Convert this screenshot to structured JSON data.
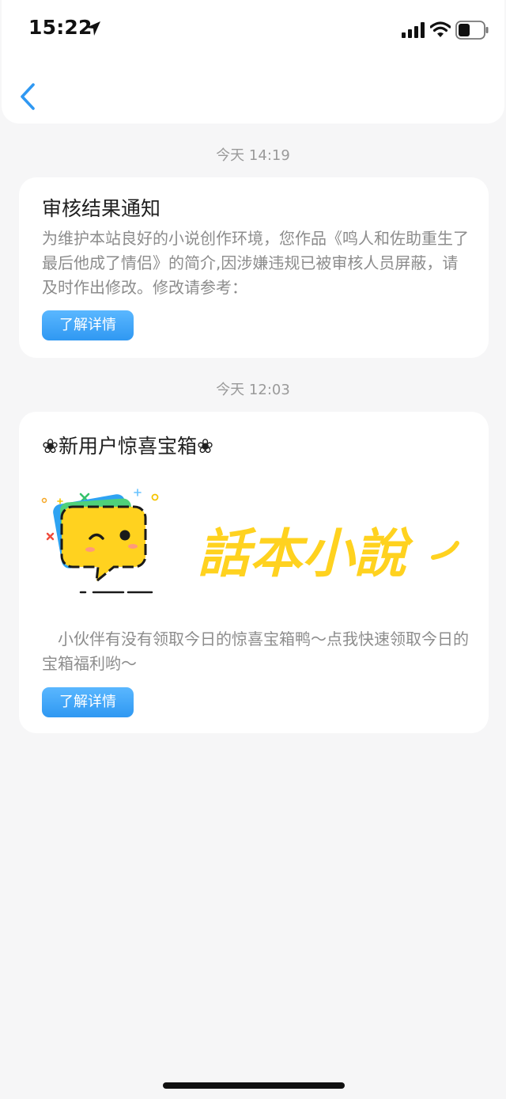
{
  "status_bar": {
    "time": "15:22",
    "icons": [
      "location-arrow-icon",
      "signal-icon",
      "wifi-icon",
      "battery-icon"
    ]
  },
  "nav": {
    "back_icon": "chevron-left-icon",
    "accent_color": "#2f98f2"
  },
  "messages": [
    {
      "time": "今天 14:19",
      "title": "审核结果通知",
      "body": "为维护本站良好的小说创作环境，您作品《鸣人和佐助重生了最后他成了情侣》的简介,因涉嫌违规已被审核人员屏蔽，请及时作出修改。修改请参考：",
      "button": "了解详情"
    },
    {
      "time": "今天 12:03",
      "title": "❀新用户惊喜宝箱❀",
      "banner": {
        "logo_text": "話本小說",
        "mascot_icon": "chat-bubble-mascot-icon"
      },
      "body": "　小伙伴有没有领取今日的惊喜宝箱鸭～点我快速领取今日的宝箱福利哟～",
      "button": "了解详情"
    }
  ]
}
